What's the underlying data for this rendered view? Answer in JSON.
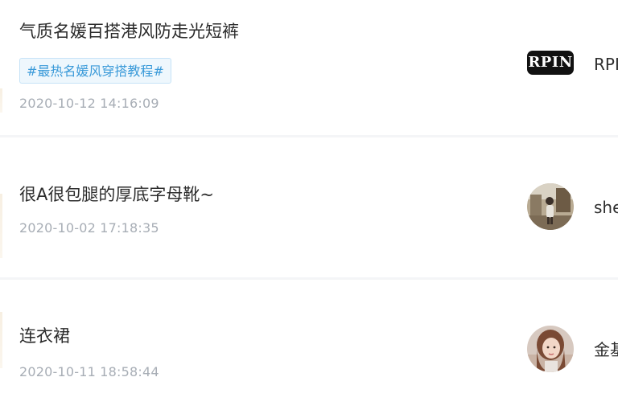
{
  "feed": {
    "posts": [
      {
        "title": "气质名媛百搭港风防走光短裤",
        "tag": "#最热名媛风穿搭教程#",
        "date": "2020-10-12 14:16:09",
        "author": {
          "logo_text": "RPIN",
          "name": "RPI"
        }
      },
      {
        "title": "很A很包腿的厚底字母靴~",
        "date": "2020-10-02 17:18:35",
        "author": {
          "name": "she"
        }
      },
      {
        "title": "连衣裙",
        "date": "2020-10-11 18:58:44",
        "author": {
          "name": "金基"
        }
      }
    ]
  },
  "colors": {
    "tag_text": "#3a9ad9",
    "tag_background": "#eef7fd",
    "tag_border": "#c6e3f7",
    "date_text": "#a7adb5",
    "separator": "#f4f5f7"
  },
  "icons": {
    "author_1_avatar": "rpin-logo-avatar",
    "author_2_avatar": "user-photo-avatar",
    "author_3_avatar": "user-photo-avatar"
  }
}
